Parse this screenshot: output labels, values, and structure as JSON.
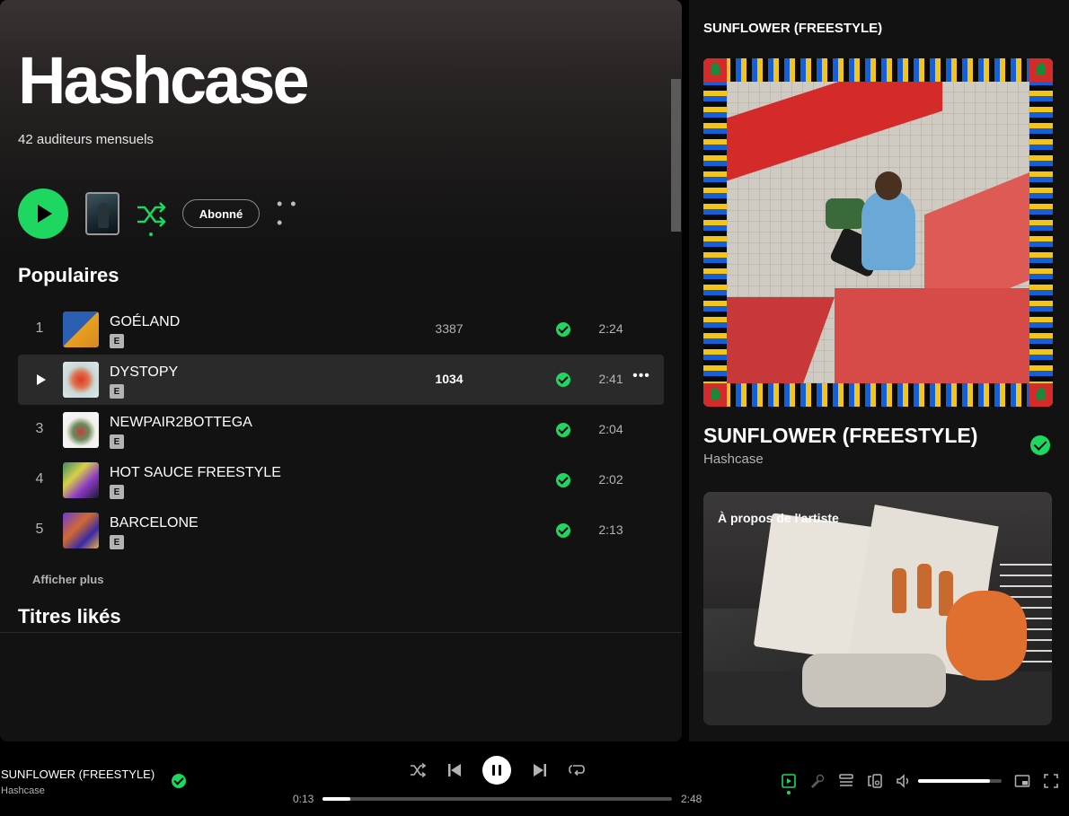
{
  "artist": {
    "name": "Hashcase",
    "monthly_listeners": "42 auditeurs mensuels"
  },
  "actions": {
    "follow_label": "Abonné",
    "more_label": "• • •"
  },
  "popular": {
    "title": "Populaires",
    "show_more": "Afficher plus",
    "tracks": [
      {
        "num": "1",
        "title": "GOÉLAND",
        "explicit": "E",
        "plays": "3387",
        "duration": "2:24",
        "saved": true
      },
      {
        "num": "2",
        "title": "DYSTOPY",
        "explicit": "E",
        "plays": "1034",
        "duration": "2:41",
        "saved": true,
        "active": true
      },
      {
        "num": "3",
        "title": "NEWPAIR2BOTTEGA",
        "explicit": "E",
        "plays": "",
        "duration": "2:04",
        "saved": true
      },
      {
        "num": "4",
        "title": "HOT SAUCE FREESTYLE",
        "explicit": "E",
        "plays": "",
        "duration": "2:02",
        "saved": true
      },
      {
        "num": "5",
        "title": "BARCELONE",
        "explicit": "E",
        "plays": "",
        "duration": "2:13",
        "saved": true
      }
    ],
    "row_more": "•••"
  },
  "liked": {
    "title": "Titres likés"
  },
  "now_playing_panel": {
    "header": "SUNFLOWER (FREESTYLE)",
    "title": "SUNFLOWER (FREESTYLE)",
    "artist": "Hashcase",
    "about_label": "À propos de l'artiste"
  },
  "player": {
    "title": "SUNFLOWER (FREESTYLE)",
    "artist": "Hashcase",
    "time_current": "0:13",
    "time_total": "2:48",
    "progress_fraction": 0.08,
    "volume_fraction": 0.86
  },
  "colors": {
    "accent": "#1ed760",
    "background": "#121212"
  }
}
